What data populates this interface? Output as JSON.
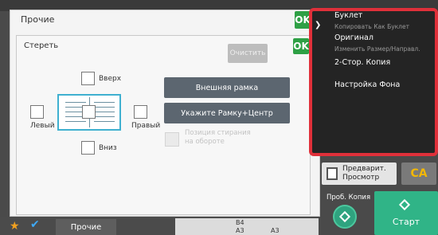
{
  "outer_dialog": {
    "title": "Прочие",
    "ok_label": "OK"
  },
  "erase_dialog": {
    "title": "Стереть",
    "ok_label": "OK",
    "clear_label": "Очистить",
    "positions": {
      "top": "Вверх",
      "left": "Левый",
      "right": "Правый",
      "bottom": "Вниз"
    },
    "buttons": {
      "outer_frame": "Внешняя рамка",
      "frame_center": "Укажите Рамку+Центр"
    },
    "back_side_label_line1": "Позиция стирания",
    "back_side_label_line2": "на обороте"
  },
  "bottom_bar": {
    "favorite_icon": "star-icon",
    "check_icon": "check-icon",
    "tab_label": "Прочие",
    "paper_labels": [
      "B4",
      "A3",
      "A3"
    ]
  },
  "right_panel": {
    "highlight_color": "#e0303a",
    "items": [
      {
        "label": "Буклет"
      },
      {
        "label": "Копировать Как Буклет",
        "sub": true
      },
      {
        "label": "Оригинал"
      },
      {
        "label": "Изменить Размер/Направл.",
        "sub": true
      },
      {
        "label": "2-Стор. Копия"
      },
      {
        "label": "Настройка Фона"
      }
    ]
  },
  "actions": {
    "preview_line1": "Предварит.",
    "preview_line2": "Просмотр",
    "ca_label": "CA",
    "proof_copy_label": "Проб. Копия",
    "start_label": "Старт",
    "start_color": "#30b487"
  }
}
